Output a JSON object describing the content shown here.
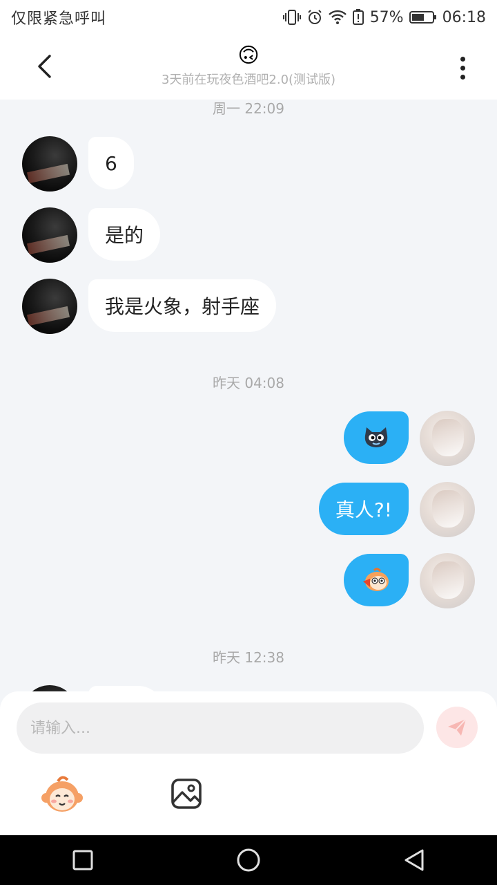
{
  "status_bar": {
    "carrier": "仅限紧急呼叫",
    "battery": "57%",
    "time": "06:18"
  },
  "header": {
    "title_emoji": "🙃",
    "subtitle": "3天前在玩夜色酒吧2.0(测试版)"
  },
  "messages": [
    {
      "type": "timestamp",
      "text": "周一 22:09"
    },
    {
      "side": "in",
      "text": "6"
    },
    {
      "side": "in",
      "text": "是的"
    },
    {
      "side": "in",
      "text": "我是火象，射手座"
    },
    {
      "type": "timestamp",
      "text": "昨天 04:08"
    },
    {
      "side": "out",
      "kind": "sticker",
      "sticker": "black-cat-face-icon"
    },
    {
      "side": "out",
      "text": "真人?!"
    },
    {
      "side": "out",
      "kind": "sticker",
      "sticker": "orange-monkey-face-icon"
    },
    {
      "type": "timestamp",
      "text": "昨天 12:38"
    }
  ],
  "composer": {
    "placeholder": "请输入..."
  },
  "colors": {
    "outgoing_bubble": "#2bb0f5",
    "incoming_bubble": "#ffffff",
    "background": "#f3f5f8",
    "send_button": "#fde6e6"
  }
}
